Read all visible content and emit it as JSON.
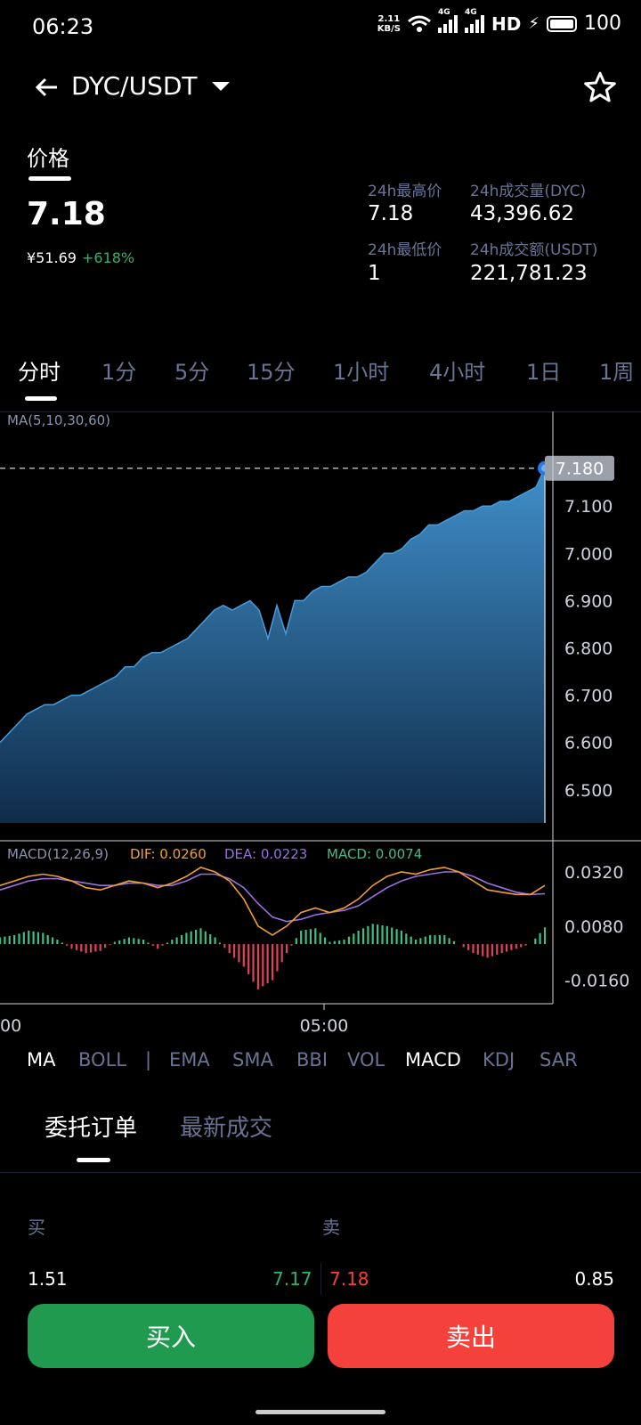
{
  "status": {
    "time": "06:23",
    "speed_top": "2.11",
    "speed_bottom": "KB/S",
    "net1": "4G",
    "net2": "4G",
    "hd": "HD",
    "battery": "100"
  },
  "header": {
    "pair": "DYC/USDT"
  },
  "price": {
    "tab_label": "价格",
    "last": "7.18",
    "cny": "¥51.69",
    "change": "+618%",
    "high_label": "24h最高价",
    "high": "7.18",
    "low_label": "24h最低价",
    "low": "1",
    "vol_label": "24h成交量(DYC)",
    "vol": "43,396.62",
    "amt_label": "24h成交额(USDT)",
    "amt": "221,781.23"
  },
  "timeframes": [
    "分时",
    "1分",
    "5分",
    "15分",
    "1小时",
    "4小时",
    "1日",
    "1周"
  ],
  "ma_legend": "MA(5,10,30,60)",
  "macd_legend": {
    "name": "MACD(12,26,9)",
    "dif": "DIF: 0.0260",
    "dea": "DEA: 0.0223",
    "macd": "MACD: 0.0074"
  },
  "indicators": [
    "MA",
    "BOLL",
    "|",
    "EMA",
    "SMA",
    "BBI",
    "VOL",
    "MACD",
    "KDJ",
    "SAR"
  ],
  "orderbook": {
    "tab1": "委托订单",
    "tab2": "最新成交",
    "buy_label": "买",
    "sell_label": "卖",
    "bid_qty": "1.51",
    "bid_price": "7.17",
    "ask_price": "7.18",
    "ask_qty": "0.85"
  },
  "buttons": {
    "buy": "买入",
    "sell": "卖出"
  },
  "colors": {
    "up": "#2fb36a",
    "down": "#f4413c",
    "dif": "#f0a030",
    "dea": "#9b6fe0",
    "macd_green": "#3fbf85",
    "macd_red": "#e0425a",
    "muted": "#6a7394"
  },
  "chart_data": [
    {
      "type": "area",
      "legend": "MA(5,10,30,60)",
      "x_ticks": [
        "00",
        "05:00"
      ],
      "y_ticks": [
        6.5,
        6.6,
        6.7,
        6.8,
        6.9,
        7.0,
        7.1
      ],
      "ylim": [
        6.43,
        7.3
      ],
      "last_value_label": "7.180",
      "last_value": 7.18,
      "values": [
        6.6,
        6.62,
        6.64,
        6.66,
        6.67,
        6.68,
        6.68,
        6.69,
        6.7,
        6.7,
        6.71,
        6.72,
        6.73,
        6.74,
        6.76,
        6.76,
        6.78,
        6.79,
        6.79,
        6.8,
        6.81,
        6.82,
        6.84,
        6.86,
        6.88,
        6.89,
        6.88,
        6.89,
        6.9,
        6.88,
        6.82,
        6.89,
        6.83,
        6.9,
        6.9,
        6.92,
        6.93,
        6.93,
        6.94,
        6.95,
        6.95,
        6.96,
        6.98,
        7.0,
        7.0,
        7.01,
        7.03,
        7.04,
        7.06,
        7.06,
        7.07,
        7.08,
        7.09,
        7.09,
        7.1,
        7.1,
        7.11,
        7.11,
        7.12,
        7.13,
        7.14,
        7.18
      ]
    },
    {
      "type": "line",
      "legend": "MACD(12,26,9)",
      "y_ticks": [
        0.032,
        0.008,
        -0.016
      ],
      "y_tick_labels": [
        "0.0320",
        "0.0080",
        "-0.0160"
      ],
      "ylim": [
        -0.026,
        0.045
      ],
      "series": [
        {
          "name": "DIF",
          "values": [
            0.026,
            0.028,
            0.03,
            0.031,
            0.03,
            0.028,
            0.025,
            0.024,
            0.026,
            0.028,
            0.027,
            0.025,
            0.027,
            0.03,
            0.034,
            0.032,
            0.028,
            0.02,
            0.008,
            0.004,
            0.008,
            0.014,
            0.016,
            0.014,
            0.016,
            0.02,
            0.026,
            0.03,
            0.032,
            0.031,
            0.033,
            0.034,
            0.032,
            0.028,
            0.024,
            0.023,
            0.022,
            0.022,
            0.026
          ]
        },
        {
          "name": "DEA",
          "values": [
            0.024,
            0.026,
            0.028,
            0.029,
            0.029,
            0.028,
            0.027,
            0.026,
            0.026,
            0.027,
            0.027,
            0.026,
            0.026,
            0.028,
            0.031,
            0.031,
            0.029,
            0.025,
            0.018,
            0.012,
            0.01,
            0.011,
            0.013,
            0.014,
            0.015,
            0.017,
            0.021,
            0.025,
            0.028,
            0.03,
            0.031,
            0.032,
            0.032,
            0.03,
            0.027,
            0.025,
            0.023,
            0.022,
            0.0223
          ]
        },
        {
          "name": "MACD",
          "values": [
            0.003,
            0.004,
            0.006,
            0.005,
            0.002,
            -0.002,
            -0.004,
            -0.003,
            0.001,
            0.003,
            0.002,
            -0.002,
            0.002,
            0.005,
            0.007,
            0.003,
            -0.004,
            -0.01,
            -0.02,
            -0.016,
            -0.004,
            0.006,
            0.007,
            0.001,
            0.002,
            0.006,
            0.009,
            0.008,
            0.006,
            0.002,
            0.004,
            0.004,
            0.0,
            -0.004,
            -0.006,
            -0.004,
            -0.002,
            0.0,
            0.0074
          ]
        }
      ]
    }
  ]
}
